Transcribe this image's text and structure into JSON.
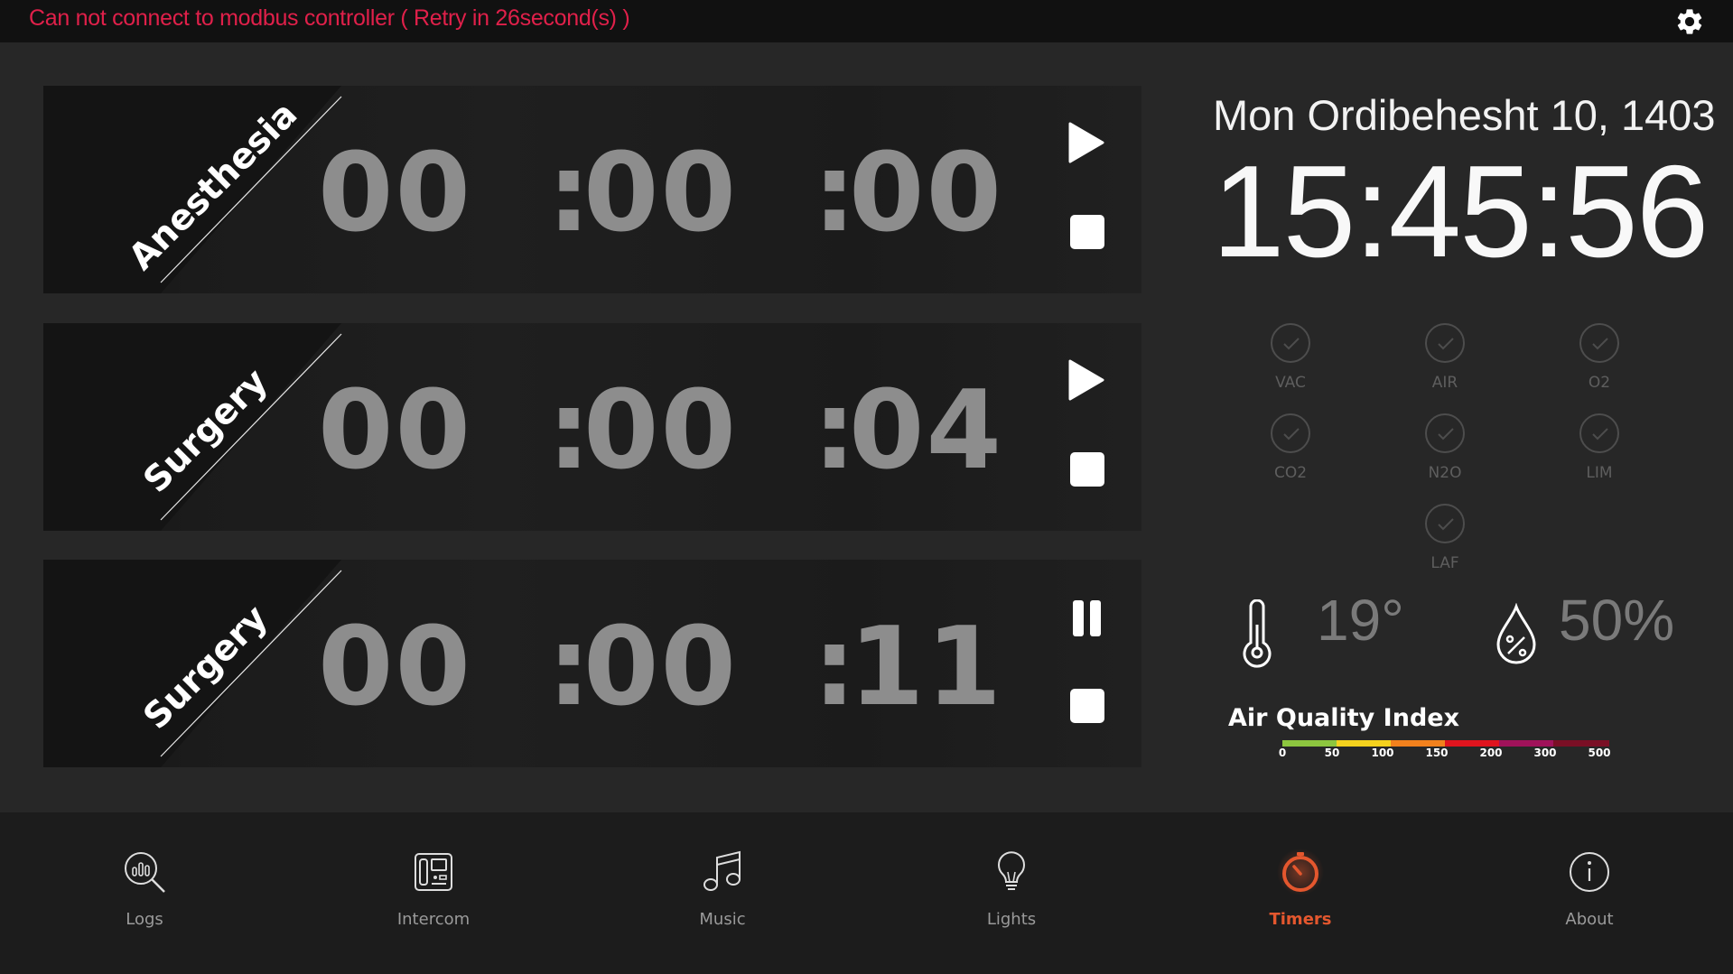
{
  "status_bar": {
    "error_message": "Can not connect to modbus controller ( Retry in 26second(s) )"
  },
  "icons": {
    "settings": "gear-icon",
    "play": "play-icon",
    "stop": "stop-icon",
    "pause": "pause-icon"
  },
  "timers": [
    {
      "label": "Anesthesia",
      "hours": "00",
      "minutes": "00",
      "seconds": "00",
      "state": "stopped"
    },
    {
      "label": "Surgery",
      "hours": "00",
      "minutes": "00",
      "seconds": "04",
      "state": "stopped"
    },
    {
      "label": "Surgery",
      "hours": "00",
      "minutes": "00",
      "seconds": "11",
      "state": "running"
    }
  ],
  "timer_separator": ":",
  "datetime": {
    "date": "Mon Ordibehesht 10, 1403",
    "time": "15:45:56"
  },
  "gases": [
    {
      "label": "VAC",
      "status": "ok"
    },
    {
      "label": "AIR",
      "status": "ok"
    },
    {
      "label": "O2",
      "status": "ok"
    },
    {
      "label": "CO2",
      "status": "ok"
    },
    {
      "label": "N2O",
      "status": "ok"
    },
    {
      "label": "LIM",
      "status": "ok"
    },
    {
      "label": "LAF",
      "status": "ok"
    }
  ],
  "environment": {
    "temperature": "19°",
    "humidity": "50%"
  },
  "air_quality": {
    "title": "Air Quality Index",
    "ticks": [
      "0",
      "50",
      "100",
      "150",
      "200",
      "300",
      "500"
    ],
    "colors": [
      "#8dc63f",
      "#f5d21e",
      "#f2811d",
      "#e0141e",
      "#a0125a",
      "#7a0f25"
    ]
  },
  "colors": {
    "error": "#e0204a",
    "accent": "#e4572e"
  },
  "nav": [
    {
      "label": "Logs",
      "icon": "logs-search-icon",
      "active": false
    },
    {
      "label": "Intercom",
      "icon": "intercom-icon",
      "active": false
    },
    {
      "label": "Music",
      "icon": "music-note-icon",
      "active": false
    },
    {
      "label": "Lights",
      "icon": "lightbulb-icon",
      "active": false
    },
    {
      "label": "Timers",
      "icon": "timer-icon",
      "active": true
    },
    {
      "label": "About",
      "icon": "info-icon",
      "active": false
    }
  ]
}
